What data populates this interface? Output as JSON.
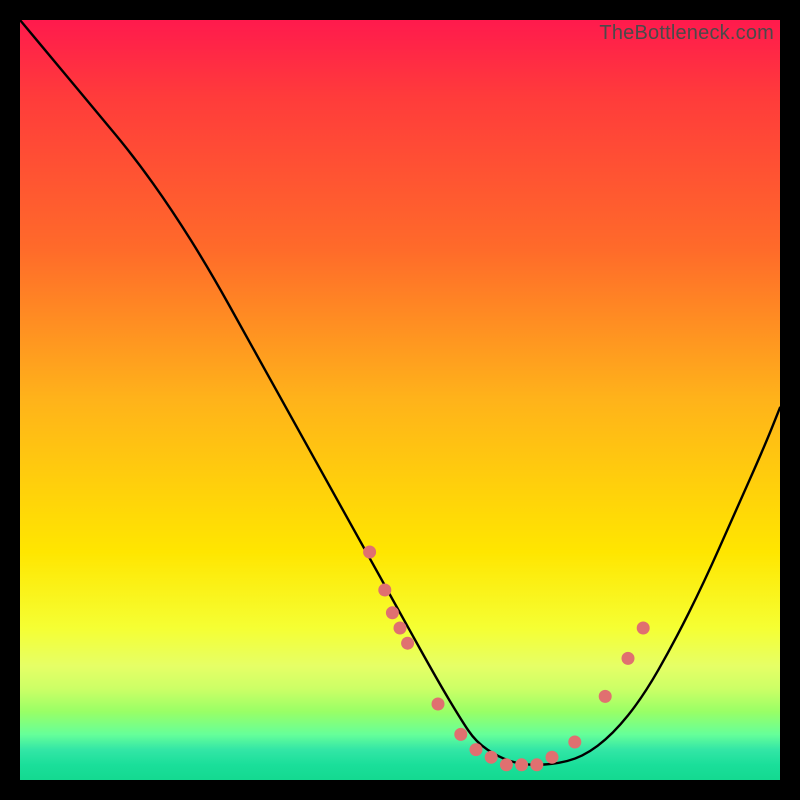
{
  "watermark": "TheBottleneck.com",
  "chart_data": {
    "type": "line",
    "title": "",
    "xlabel": "",
    "ylabel": "",
    "xlim": [
      0,
      100
    ],
    "ylim": [
      0,
      100
    ],
    "series": [
      {
        "name": "bottleneck-curve",
        "x": [
          0,
          5,
          10,
          15,
          20,
          25,
          30,
          35,
          40,
          45,
          50,
          55,
          58,
          60,
          63,
          66,
          70,
          74,
          78,
          82,
          86,
          90,
          94,
          98,
          100
        ],
        "y": [
          100,
          94,
          88,
          82,
          75,
          67,
          58,
          49,
          40,
          31,
          22,
          13,
          8,
          5,
          3,
          2,
          2,
          3,
          6,
          11,
          18,
          26,
          35,
          44,
          49
        ]
      }
    ],
    "markers": {
      "name": "highlight-points",
      "color": "#e07070",
      "x": [
        46,
        48,
        49,
        50,
        51,
        55,
        58,
        60,
        62,
        64,
        66,
        68,
        70,
        73,
        77,
        80,
        82
      ],
      "y": [
        30,
        25,
        22,
        20,
        18,
        10,
        6,
        4,
        3,
        2,
        2,
        2,
        3,
        5,
        11,
        16,
        20
      ]
    },
    "background_gradient": {
      "top": "#ff1a4d",
      "mid": "#ffe600",
      "bottom": "#14d990"
    }
  }
}
